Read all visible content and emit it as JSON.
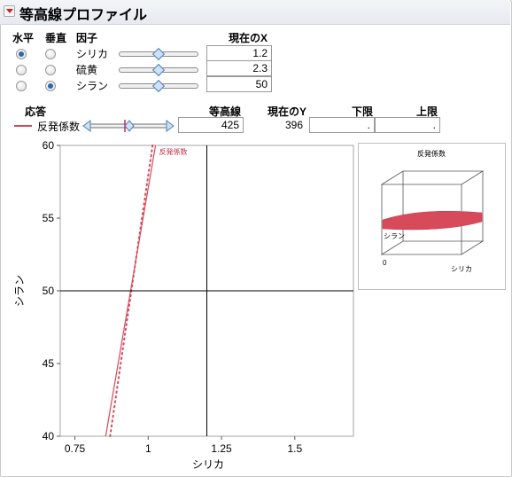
{
  "title": "等高線プロファイル",
  "factors": {
    "col_horizontal": "水平",
    "col_vertical": "垂直",
    "col_factor": "因子",
    "col_current_x": "現在のX",
    "rows": [
      {
        "name": "シリカ",
        "value": "1.2",
        "horizontal": true,
        "vertical": false
      },
      {
        "name": "硫黄",
        "value": "2.3",
        "horizontal": false,
        "vertical": false
      },
      {
        "name": "シラン",
        "value": "50",
        "horizontal": false,
        "vertical": true
      }
    ]
  },
  "responses": {
    "col_response": "応答",
    "col_contour": "等高線",
    "col_current_y": "現在のY",
    "col_lower": "下限",
    "col_upper": "上限",
    "row": {
      "name": "反発係数",
      "contour": "425",
      "current_y": "396",
      "lower": ".",
      "upper": "."
    }
  },
  "chart_data": {
    "type": "line",
    "xlabel": "シリカ",
    "ylabel": "シラン",
    "x_ticks": [
      "0.75",
      "1",
      "1.25",
      "1.5"
    ],
    "y_ticks": [
      "40",
      "45",
      "50",
      "55",
      "60"
    ],
    "xlim": [
      0.7,
      1.7
    ],
    "ylim": [
      40,
      60
    ],
    "crosshair": {
      "x": 1.2,
      "y": 50
    },
    "contour_label": "反発係数",
    "contour_color": "#d64a5a",
    "series": [
      {
        "name": "反発係数",
        "style": "solid",
        "x": [
          0.855,
          1.025
        ],
        "y": [
          40,
          60
        ]
      },
      {
        "name": "反発係数",
        "style": "dotted",
        "x": [
          0.87,
          1.015
        ],
        "y": [
          40,
          60
        ]
      }
    ]
  },
  "mini3d": {
    "title": "反発係数",
    "label_y": "シラン",
    "label_x": "シリカ",
    "label_zero": "0",
    "surface_color": "#d64a5a"
  }
}
